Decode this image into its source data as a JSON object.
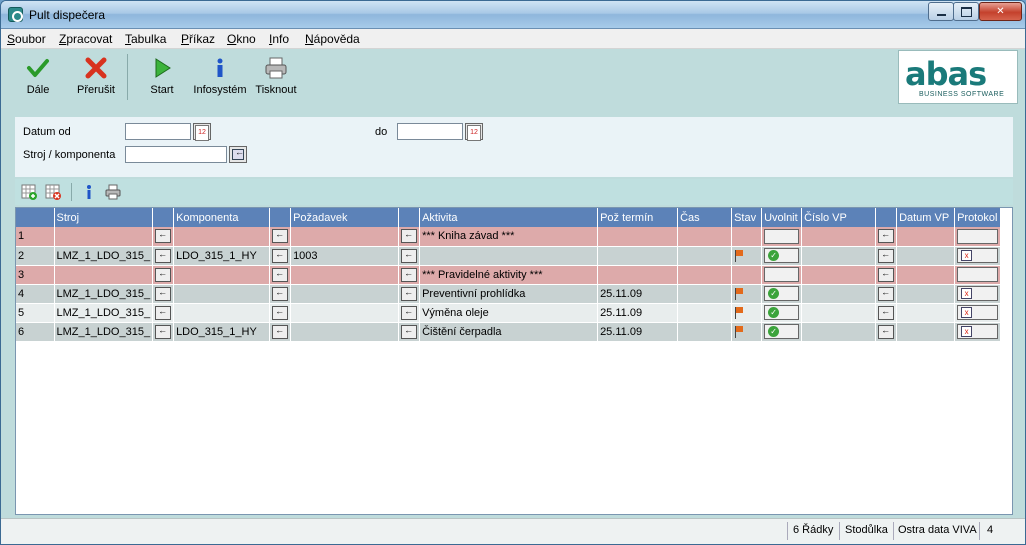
{
  "window": {
    "title": "Pult dispečera"
  },
  "menu": [
    "Soubor",
    "Zpracovat",
    "Tabulka",
    "Příkaz",
    "Okno",
    "Info",
    "Nápověda"
  ],
  "toolbar": {
    "dale": "Dále",
    "prerusit": "Přerušit",
    "start": "Start",
    "infosystem": "Infosystém",
    "tisknout": "Tisknout"
  },
  "logo": {
    "word": "abas",
    "sub": "BUSINESS SOFTWARE"
  },
  "form": {
    "datum_od_label": "Datum od",
    "datum_od_value": "",
    "do_label": "do",
    "do_value": "",
    "stroj_label": "Stroj / komponenta",
    "stroj_value": ""
  },
  "grid": {
    "headers": {
      "stroj": "Stroj",
      "komponenta": "Komponenta",
      "pozadavek": "Požadavek",
      "aktivita": "Aktivita",
      "poz_termin": "Pož termín",
      "cas": "Čas",
      "stav": "Stav",
      "uvolnit": "Uvolnit",
      "cislo_vp": "Číslo VP",
      "datum_vp": "Datum VP",
      "protokol": "Protokol"
    },
    "rows": [
      {
        "num": "1",
        "stroj": "",
        "komponenta": "",
        "pozadavek": "",
        "aktivita": "*** Kniha závad ***",
        "termin": "",
        "cas": ""
      },
      {
        "num": "2",
        "stroj": "LMZ_1_LDO_315_",
        "komponenta": "LDO_315_1_HY",
        "pozadavek": "1003",
        "aktivita": "",
        "termin": "",
        "cas": ""
      },
      {
        "num": "3",
        "stroj": "",
        "komponenta": "",
        "pozadavek": "",
        "aktivita": "*** Pravidelné aktivity ***",
        "termin": "",
        "cas": ""
      },
      {
        "num": "4",
        "stroj": "LMZ_1_LDO_315_",
        "komponenta": "",
        "pozadavek": "",
        "aktivita": "Preventivní prohlídka",
        "termin": "25.11.09",
        "cas": ""
      },
      {
        "num": "5",
        "stroj": "LMZ_1_LDO_315_",
        "komponenta": "",
        "pozadavek": "",
        "aktivita": "Výměna oleje",
        "termin": "25.11.09",
        "cas": ""
      },
      {
        "num": "6",
        "stroj": "LMZ_1_LDO_315_",
        "komponenta": "LDO_315_1_HY",
        "pozadavek": "",
        "aktivita": "Čištění čerpadla",
        "termin": "25.11.09",
        "cas": ""
      }
    ]
  },
  "status": {
    "rows": "6 Řádky",
    "user": "Stodůlka",
    "db": "Ostra data VIVA",
    "num": "4"
  }
}
